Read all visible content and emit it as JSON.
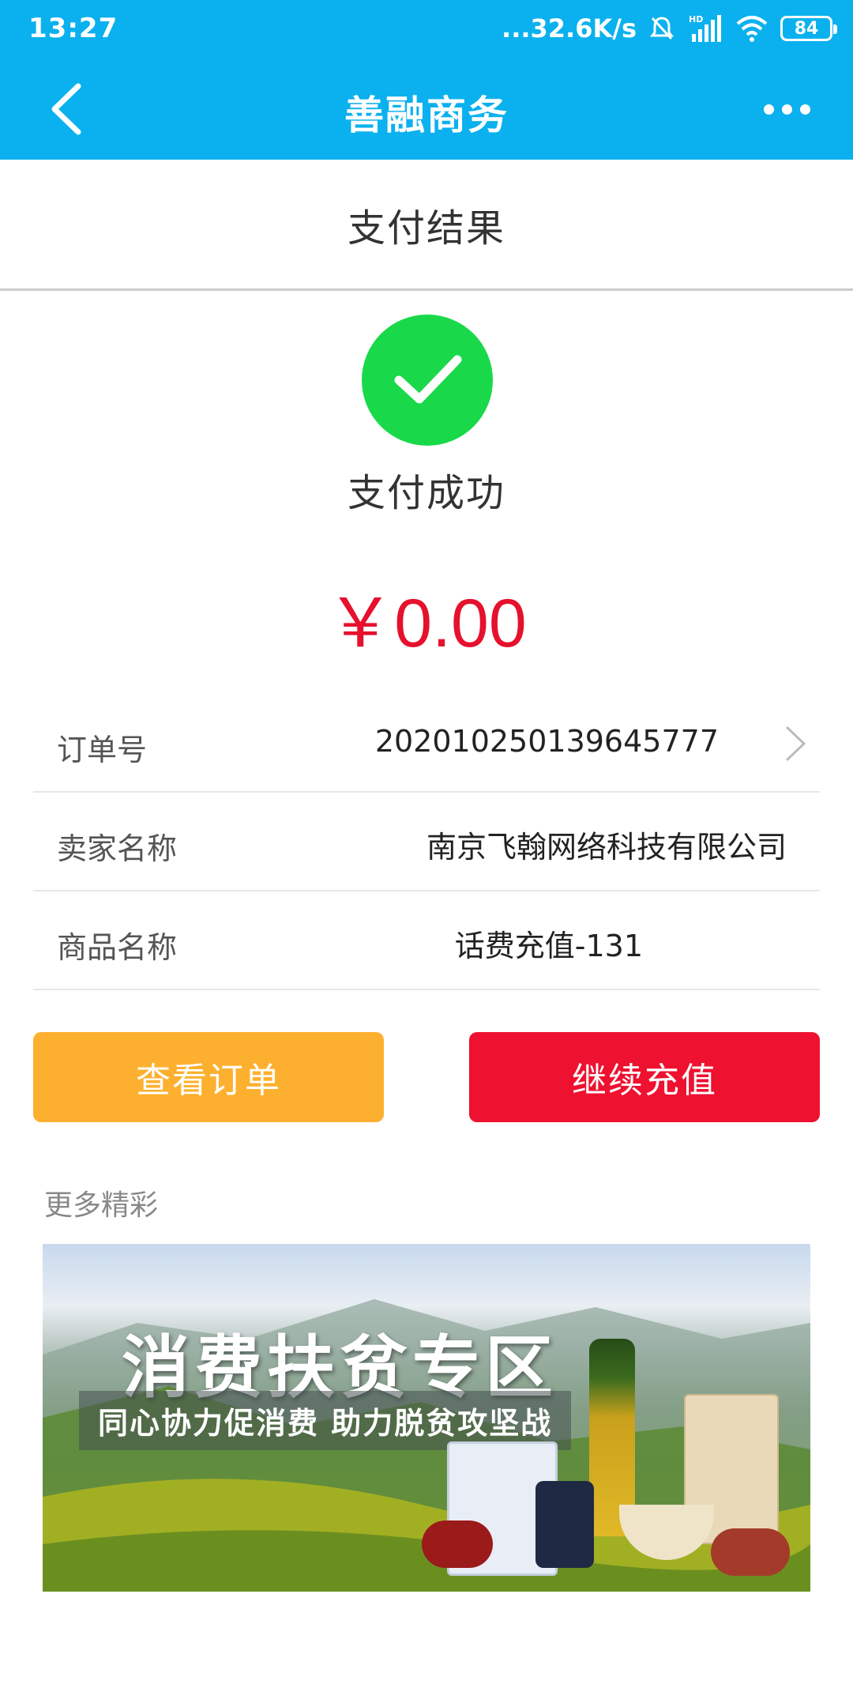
{
  "status_bar": {
    "time": "13:27",
    "network_speed": "...32.6K/s",
    "battery": "84",
    "hd_label": "HD"
  },
  "app_bar": {
    "title": "善融商务",
    "back_icon": "chevron-left-icon",
    "more_icon": "more-dots-icon"
  },
  "subheader": {
    "title": "支付结果"
  },
  "result": {
    "status": "支付成功",
    "amount": "￥0.00",
    "icon": "check-circle-icon",
    "success_color": "#19d94a",
    "amount_color": "#e5112d"
  },
  "info": {
    "order": {
      "label": "订单号",
      "value": "202010250139645777"
    },
    "seller": {
      "label": "卖家名称",
      "value": "南京飞翰网络科技有限公司"
    },
    "product": {
      "label": "商品名称",
      "value": "话费充值-131"
    }
  },
  "buttons": {
    "view_order": "查看订单",
    "continue_recharge": "继续充值",
    "view_color": "#fdb02f",
    "continue_color": "#ee1130"
  },
  "more": {
    "title": "更多精彩",
    "banner": {
      "title": "消费扶贫专区",
      "subtitle": "同心协力促消费 助力脱贫攻坚战"
    }
  },
  "colors": {
    "header": "#0bb1ee"
  }
}
